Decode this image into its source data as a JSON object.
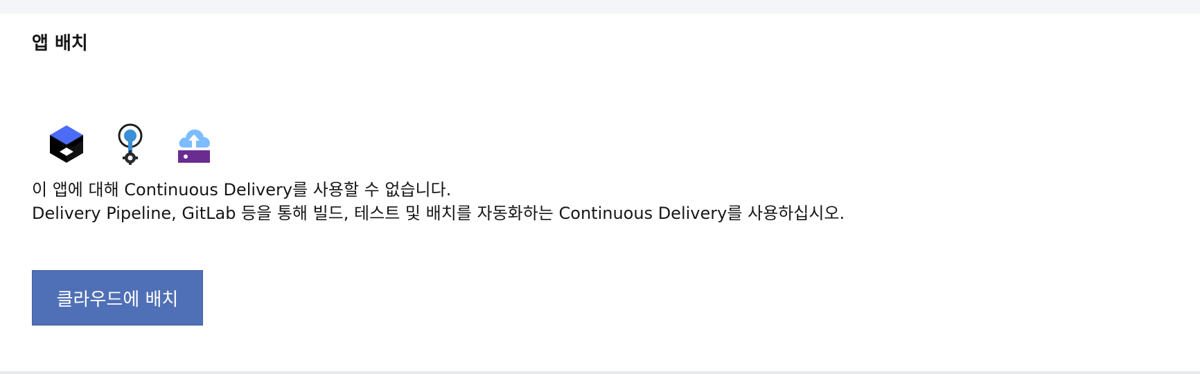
{
  "section": {
    "title": "앱 배치"
  },
  "icons": [
    {
      "name": "code-engine-icon",
      "color": "#4b6cf7"
    },
    {
      "name": "git-repo-gear-icon",
      "color": "#3a8fd6"
    },
    {
      "name": "cloud-upload-server-icon",
      "color": "#74b7ff"
    }
  ],
  "description": {
    "line1": "이 앱에 대해 Continuous Delivery를 사용할 수 없습니다.",
    "line2": "Delivery Pipeline, GitLab 등을 통해 빌드, 테스트 및 배치를 자동화하는 Continuous Delivery를 사용하십시오."
  },
  "actions": {
    "deploy_label": "클라우드에 배치"
  },
  "colors": {
    "button_bg": "#4f70b6",
    "page_bg": "#f4f5f8",
    "card_bg": "#ffffff"
  }
}
